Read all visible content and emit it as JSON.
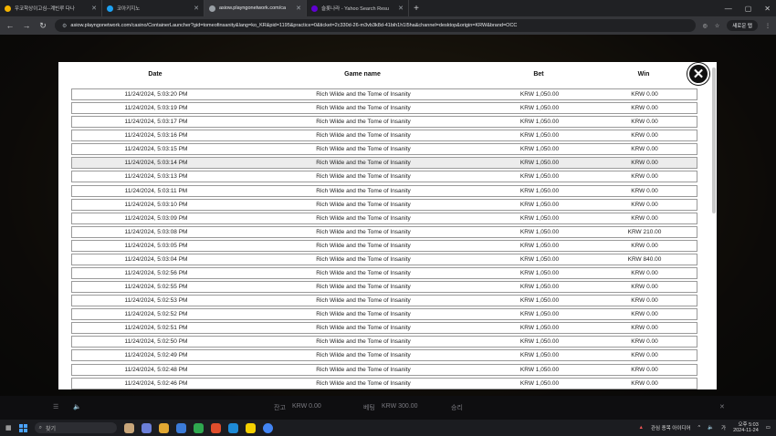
{
  "browser": {
    "tabs": [
      {
        "title": "우코학상이고심--계빈루 다나",
        "active": false,
        "color": "#f4b400"
      },
      {
        "title": "코아키지노",
        "active": false,
        "color": "#1da1f2"
      },
      {
        "title": "asiow.playngonetwork.com/ca",
        "active": true,
        "color": "#9aa0a6"
      },
      {
        "title": "슬롯나라 - Yahoo Search Resu",
        "active": false,
        "color": "#6001d2"
      }
    ],
    "new_tab": "+",
    "url": "asiow.playngonetwork.com/casino/ContainerLauncher?gid=tomeofinsanity&lang=ko_KR&pid=1195&practice=0&ticket=2c330d-26-m3vb3k8d-41bih1h1l5ha&channel=desktop&origin=KRW&brand=OCC",
    "profile_label": "새로운 탭"
  },
  "modal": {
    "headers": {
      "date": "Date",
      "game": "Game name",
      "bet": "Bet",
      "win": "Win"
    },
    "close_glyph": "✕",
    "rows": [
      {
        "date": "11/24/2024, 5:03:20 PM",
        "game": "Rich Wilde and the Tome of Insanity",
        "bet": "KRW 1,050.00",
        "win": "KRW 0.00"
      },
      {
        "date": "11/24/2024, 5:03:19 PM",
        "game": "Rich Wilde and the Tome of Insanity",
        "bet": "KRW 1,050.00",
        "win": "KRW 0.00"
      },
      {
        "date": "11/24/2024, 5:03:17 PM",
        "game": "Rich Wilde and the Tome of Insanity",
        "bet": "KRW 1,050.00",
        "win": "KRW 0.00"
      },
      {
        "date": "11/24/2024, 5:03:16 PM",
        "game": "Rich Wilde and the Tome of Insanity",
        "bet": "KRW 1,050.00",
        "win": "KRW 0.00"
      },
      {
        "date": "11/24/2024, 5:03:15 PM",
        "game": "Rich Wilde and the Tome of Insanity",
        "bet": "KRW 1,050.00",
        "win": "KRW 0.00"
      },
      {
        "date": "11/24/2024, 5:03:14 PM",
        "game": "Rich Wilde and the Tome of Insanity",
        "bet": "KRW 1,050.00",
        "win": "KRW 0.00",
        "highlight": true
      },
      {
        "date": "11/24/2024, 5:03:13 PM",
        "game": "Rich Wilde and the Tome of Insanity",
        "bet": "KRW 1,050.00",
        "win": "KRW 0.00"
      },
      {
        "date": "11/24/2024, 5:03:11 PM",
        "game": "Rich Wilde and the Tome of Insanity",
        "bet": "KRW 1,050.00",
        "win": "KRW 0.00"
      },
      {
        "date": "11/24/2024, 5:03:10 PM",
        "game": "Rich Wilde and the Tome of Insanity",
        "bet": "KRW 1,050.00",
        "win": "KRW 0.00"
      },
      {
        "date": "11/24/2024, 5:03:09 PM",
        "game": "Rich Wilde and the Tome of Insanity",
        "bet": "KRW 1,050.00",
        "win": "KRW 0.00"
      },
      {
        "date": "11/24/2024, 5:03:08 PM",
        "game": "Rich Wilde and the Tome of Insanity",
        "bet": "KRW 1,050.00",
        "win": "KRW 210.00"
      },
      {
        "date": "11/24/2024, 5:03:05 PM",
        "game": "Rich Wilde and the Tome of Insanity",
        "bet": "KRW 1,050.00",
        "win": "KRW 0.00"
      },
      {
        "date": "11/24/2024, 5:03:04 PM",
        "game": "Rich Wilde and the Tome of Insanity",
        "bet": "KRW 1,050.00",
        "win": "KRW 840.00"
      },
      {
        "date": "11/24/2024, 5:02:56 PM",
        "game": "Rich Wilde and the Tome of Insanity",
        "bet": "KRW 1,050.00",
        "win": "KRW 0.00"
      },
      {
        "date": "11/24/2024, 5:02:55 PM",
        "game": "Rich Wilde and the Tome of Insanity",
        "bet": "KRW 1,050.00",
        "win": "KRW 0.00"
      },
      {
        "date": "11/24/2024, 5:02:53 PM",
        "game": "Rich Wilde and the Tome of Insanity",
        "bet": "KRW 1,050.00",
        "win": "KRW 0.00"
      },
      {
        "date": "11/24/2024, 5:02:52 PM",
        "game": "Rich Wilde and the Tome of Insanity",
        "bet": "KRW 1,050.00",
        "win": "KRW 0.00"
      },
      {
        "date": "11/24/2024, 5:02:51 PM",
        "game": "Rich Wilde and the Tome of Insanity",
        "bet": "KRW 1,050.00",
        "win": "KRW 0.00"
      },
      {
        "date": "11/24/2024, 5:02:50 PM",
        "game": "Rich Wilde and the Tome of Insanity",
        "bet": "KRW 1,050.00",
        "win": "KRW 0.00"
      },
      {
        "date": "11/24/2024, 5:02:49 PM",
        "game": "Rich Wilde and the Tome of Insanity",
        "bet": "KRW 1,050.00",
        "win": "KRW 0.00"
      },
      {
        "date": "11/24/2024, 5:02:48 PM",
        "game": "Rich Wilde and the Tome of Insanity",
        "bet": "KRW 1,050.00",
        "win": "KRW 0.00"
      },
      {
        "date": "11/24/2024, 5:02:46 PM",
        "game": "Rich Wilde and the Tome of Insanity",
        "bet": "KRW 1,050.00",
        "win": "KRW 0.00"
      }
    ]
  },
  "game_bar": {
    "credit": "KRW 0.00",
    "balance_label": "잔고",
    "balance_value": "KRW 0.00",
    "bet_label": "베팅",
    "bet_value": "KRW 300.00",
    "win_label": "승리"
  },
  "taskbar": {
    "search_placeholder": "찾기",
    "tray_text": "관심 종목 아이디어",
    "time": "오후 5:03",
    "date": "2024-11-24"
  }
}
